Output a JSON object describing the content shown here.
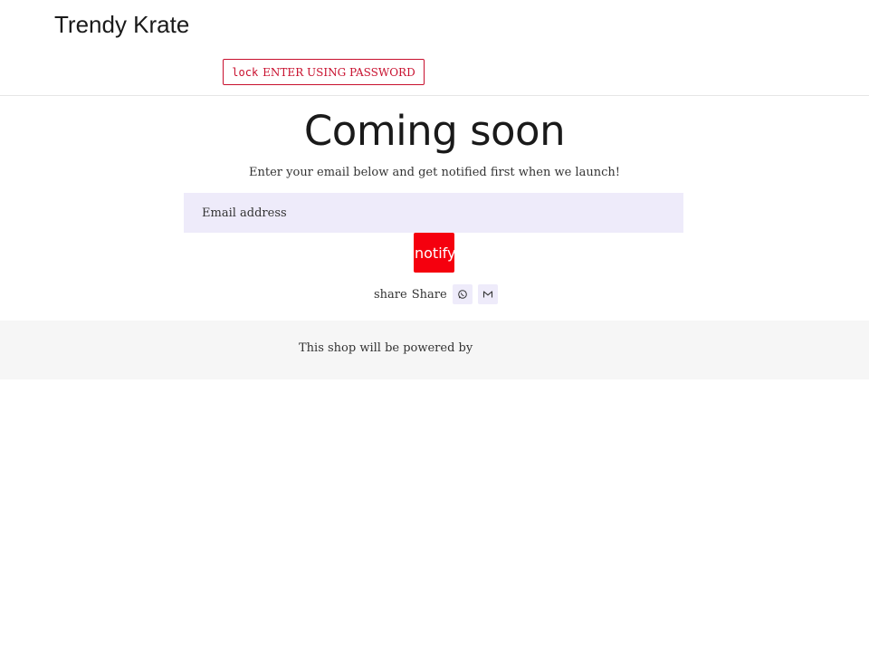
{
  "header": {
    "brand": "Trendy Krate",
    "password_button": {
      "icon_text": "lock",
      "label": "ENTER USING PASSWORD"
    }
  },
  "main": {
    "heading": "Coming soon",
    "subtitle": "Enter your email below and get notified first when we launch!",
    "email_placeholder": "Email address",
    "notify_button_label": "notify me",
    "share": {
      "icon_text": "share",
      "label": "Share",
      "buttons": [
        {
          "icon": "whatsapp-icon"
        },
        {
          "icon": "email-icon"
        }
      ]
    }
  },
  "footer": {
    "text": "This shop will be powered by"
  },
  "colors": {
    "accent": "#c8102e",
    "notify_button": "#f5000e",
    "field_background": "#eeebfa",
    "footer_background": "#f6f6f6"
  }
}
